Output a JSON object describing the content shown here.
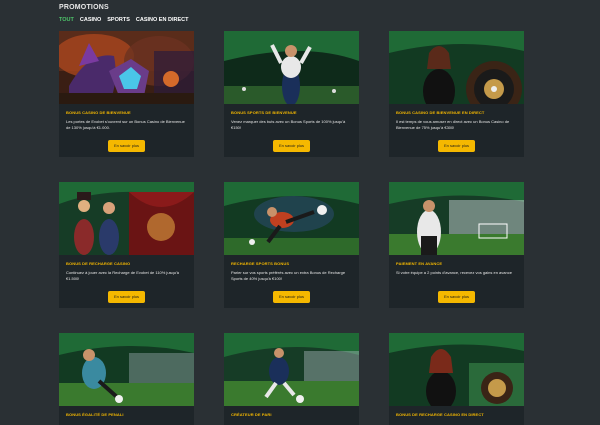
{
  "header": {
    "title": "PROMOTIONS",
    "tabs": [
      "TOUT",
      "CASINO",
      "SPORTS",
      "CASINO EN DIRECT"
    ]
  },
  "colors": {
    "background": "#2a3034",
    "card": "#1e2529",
    "accent_yellow": "#f5b800",
    "tab_active": "#4dc46a"
  },
  "cards": [
    {
      "image_icon": "casino-knight-icon",
      "title": "BONUS CASINO DE BIENVENUE",
      "text": "Les portes de Evobet s'ouvrent sur un Bonus Casino de Bienvenue de 130% jusqu'à €1.000.",
      "button": "En savoir plus"
    },
    {
      "image_icon": "football-player-icon",
      "title": "BONUS SPORTS DE BIENVENUE",
      "text": "Venez marquer des buts avec un Bonus Sports de 100% jusqu'à €150!",
      "button": "En savoir plus"
    },
    {
      "image_icon": "roulette-dealer-icon",
      "title": "BONUS CASINO DE BIENVENUE EN DIRECT",
      "text": "Il est temps de vous amuser en direct avec un Bonus Casino de Bienvenue de 75% jusqu'à €300!",
      "button": "En savoir plus"
    },
    {
      "image_icon": "circus-performers-icon",
      "title": "BONUS DE RECHARGE CASINO",
      "text": "Continuez à jouer avec la Recharge de Evobet de 110% jusqu'à €1.500!",
      "button": "En savoir plus"
    },
    {
      "image_icon": "soccer-kick-icon",
      "title": "RECHARGE SPORTS BONUS",
      "text": "Parier sur vos sports préférés avec un extra Bonus de Recharge Sports de 40% jusqu'à €100!",
      "button": "En savoir plus"
    },
    {
      "image_icon": "stadium-player-icon",
      "title": "PAIEMENT EN AVANCE",
      "text": "Si votre équipe a 2 points d'avance, recevez vos gains en avance",
      "button": "En savoir plus"
    },
    {
      "image_icon": "goalkeeper-icon",
      "title": "BONUS ÉGALITÉ DE PENALI",
      "text": "",
      "button": ""
    },
    {
      "image_icon": "dribbling-player-icon",
      "title": "CRÉATEUR DE PARI",
      "text": "",
      "button": ""
    },
    {
      "image_icon": "live-roulette-icon",
      "title": "BONUS DE RECHARGE CASINO EN DIRECT",
      "text": "",
      "button": ""
    }
  ]
}
